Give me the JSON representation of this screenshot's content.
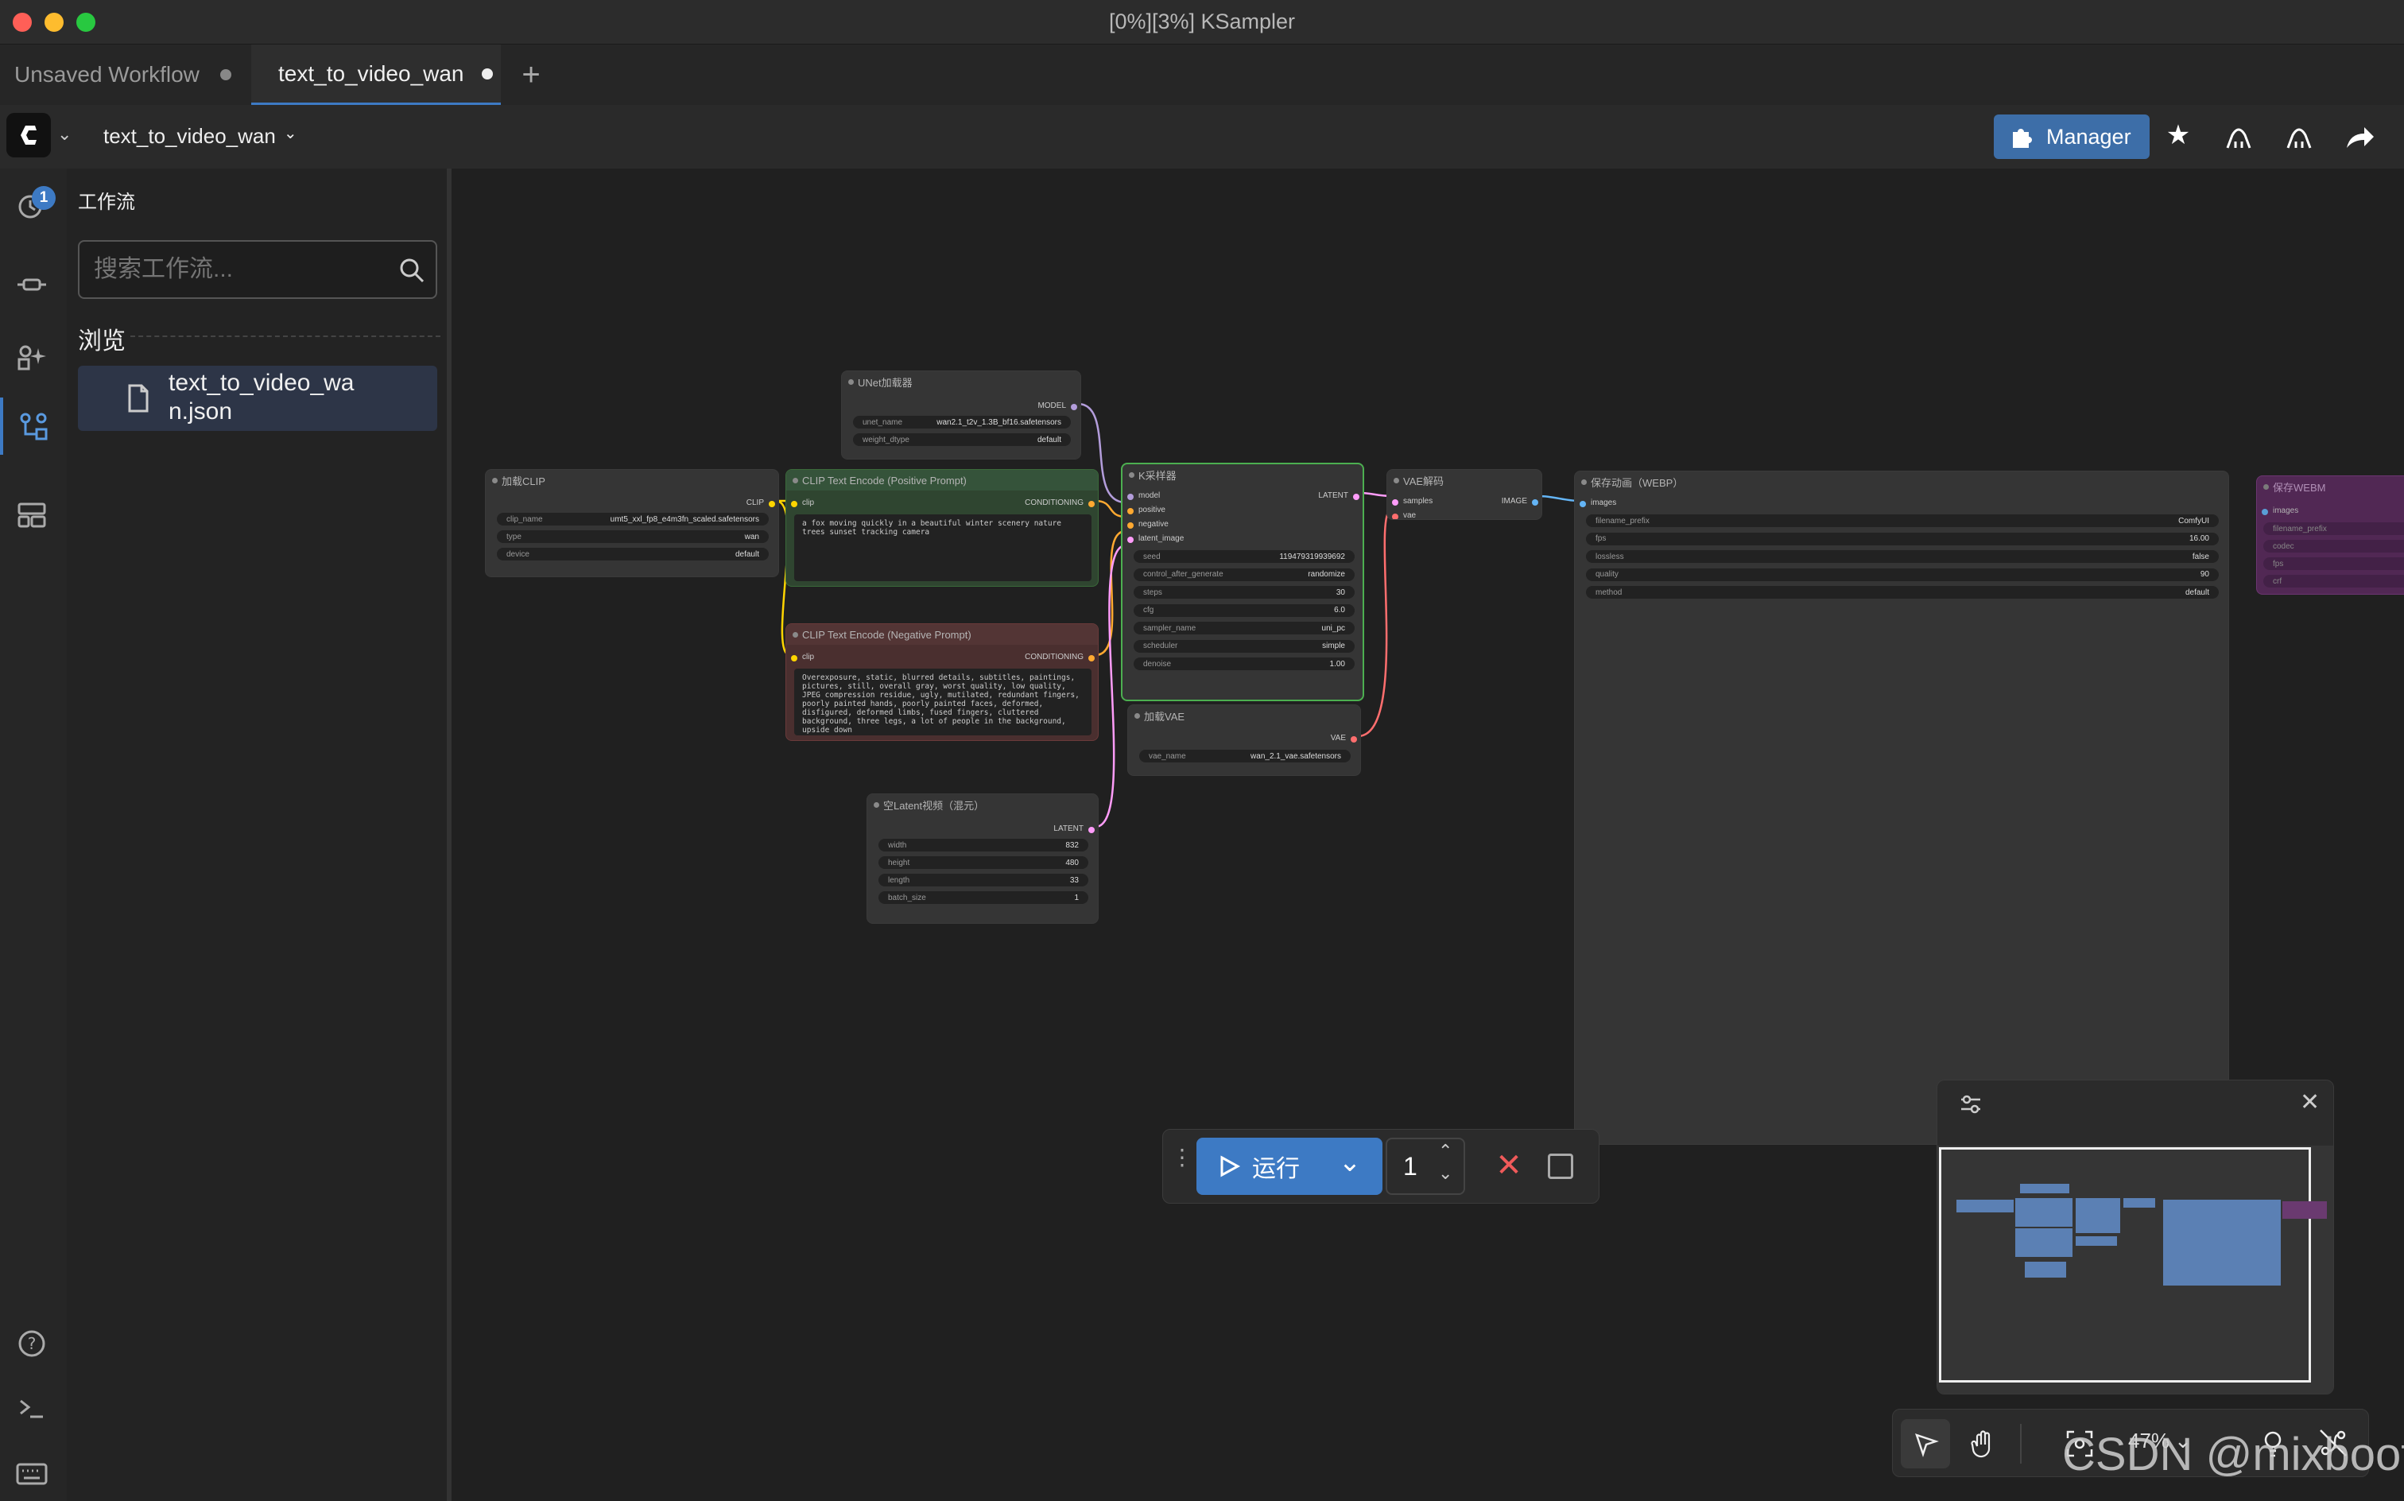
{
  "window": {
    "title": "[0%][3%] KSampler",
    "traffic_lights": [
      "#ff5f57",
      "#febc2e",
      "#28c840"
    ]
  },
  "tabs": [
    {
      "label": "Unsaved Workflow",
      "active": false
    },
    {
      "label": "text_to_video_wan",
      "active": true
    }
  ],
  "topbar": {
    "workflow_name": "text_to_video_wan",
    "manager_label": "Manager",
    "accent": "#3d6ea8"
  },
  "sidebar_badge": "1",
  "panel": {
    "title": "工作流",
    "search_placeholder": "搜索工作流...",
    "browse_label": "浏览",
    "file_name": "text_to_video_wan.json",
    "file_label": "text_to_video_wa\nn.json"
  },
  "nodes": {
    "unet": {
      "title": "UNet加载器",
      "out": "MODEL",
      "w1_label": "unet_name",
      "w1_value": "wan2.1_t2v_1.3B_bf16.safetensors",
      "w2_label": "weight_dtype",
      "w2_value": "default"
    },
    "clip": {
      "title": "加载CLIP",
      "out": "CLIP",
      "w1_label": "clip_name",
      "w1_value": "umt5_xxl_fp8_e4m3fn_scaled.safetensors",
      "w2_label": "type",
      "w2_value": "wan",
      "w3_label": "device",
      "w3_value": "default"
    },
    "pos": {
      "title": "CLIP Text Encode (Positive Prompt)",
      "in": "clip",
      "out": "CONDITIONING",
      "text": "a fox moving quickly in a beautiful winter scenery nature trees sunset tracking camera"
    },
    "neg": {
      "title": "CLIP Text Encode (Negative Prompt)",
      "in": "clip",
      "out": "CONDITIONING",
      "text": "Overexposure, static, blurred details, subtitles, paintings, pictures, still, overall gray, worst quality, low quality, JPEG compression residue, ugly, mutilated, redundant fingers, poorly painted hands, poorly painted faces, deformed, disfigured, deformed limbs, fused fingers, cluttered background, three legs, a lot of people in the background, upside down"
    },
    "latent": {
      "title": "空Latent视频（混元）",
      "out": "LATENT",
      "w1_label": "width",
      "w1_value": "832",
      "w2_label": "height",
      "w2_value": "480",
      "w3_label": "length",
      "w3_value": "33",
      "w4_label": "batch_size",
      "w4_value": "1"
    },
    "ks": {
      "title": "K采样器",
      "in1": "model",
      "in2": "positive",
      "in3": "negative",
      "in4": "latent_image",
      "out": "LATENT",
      "w1_label": "seed",
      "w1_value": "119479319939692",
      "w2_label": "control_after_generate",
      "w2_value": "randomize",
      "w3_label": "steps",
      "w3_value": "30",
      "w4_label": "cfg",
      "w4_value": "6.0",
      "w5_label": "sampler_name",
      "w5_value": "uni_pc",
      "w6_label": "scheduler",
      "w6_value": "simple",
      "w7_label": "denoise",
      "w7_value": "1.00"
    },
    "vae": {
      "title": "加载VAE",
      "out": "VAE",
      "w1_label": "vae_name",
      "w1_value": "wan_2.1_vae.safetensors"
    },
    "vaed": {
      "title": "VAE解码",
      "in1": "samples",
      "in2": "vae",
      "out": "IMAGE"
    },
    "save": {
      "title": "保存动画（WEBP）",
      "in": "images",
      "w1_label": "filename_prefix",
      "w1_value": "ComfyUI",
      "w2_label": "fps",
      "w2_value": "16.00",
      "w3_label": "lossless",
      "w3_value": "false",
      "w4_label": "quality",
      "w4_value": "90",
      "w5_label": "method",
      "w5_value": "default"
    },
    "cut": {
      "title": "保存WEBM",
      "in": "images",
      "w1": "filename_prefix",
      "w2": "codec",
      "w3": "fps",
      "w4": "crf"
    }
  },
  "runbar": {
    "run_label": "运行",
    "count": "1"
  },
  "zoom": {
    "level": "47%"
  },
  "watermark": "CSDN @mixboot"
}
